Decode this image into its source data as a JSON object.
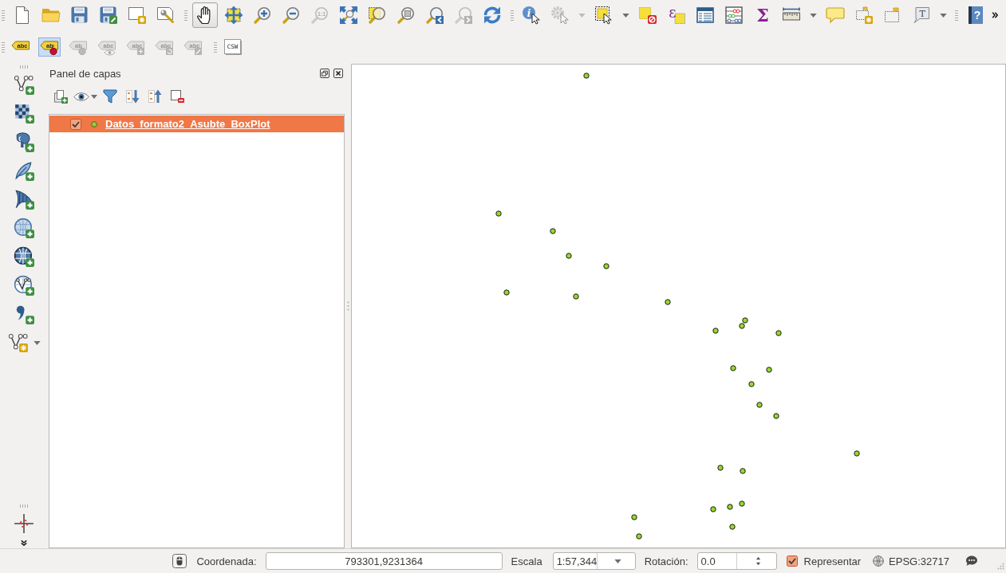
{
  "toolbar_rows": [
    [
      {
        "items": [
          {
            "kind": "new",
            "selected": false,
            "disabled": false
          },
          {
            "kind": "open",
            "selected": false,
            "disabled": false
          },
          {
            "kind": "save",
            "selected": false,
            "disabled": false
          },
          {
            "kind": "saveas",
            "selected": false,
            "disabled": false
          },
          {
            "kind": "newlayout",
            "selected": false,
            "disabled": false
          },
          {
            "kind": "layoutmanager",
            "selected": false,
            "disabled": false
          }
        ]
      },
      {
        "items": [
          {
            "kind": "pan",
            "selected": true,
            "disabled": false
          },
          {
            "kind": "pantoselection",
            "selected": false,
            "disabled": false
          },
          {
            "kind": "zoomin",
            "selected": false,
            "disabled": false
          },
          {
            "kind": "zoomout",
            "selected": false,
            "disabled": false
          },
          {
            "kind": "zoomnative",
            "glyph": "1:1",
            "selected": false,
            "disabled": true
          },
          {
            "kind": "zoomfull",
            "selected": false,
            "disabled": false
          },
          {
            "kind": "zoomlayer",
            "selected": false,
            "disabled": false
          },
          {
            "kind": "zoomselection",
            "selected": false,
            "disabled": false
          },
          {
            "kind": "zoomlast",
            "selected": false,
            "disabled": false
          },
          {
            "kind": "zoomnext",
            "selected": false,
            "disabled": true
          },
          {
            "kind": "refresh",
            "selected": false,
            "disabled": false
          }
        ]
      },
      {
        "items": [
          {
            "kind": "identify",
            "glyph": "i",
            "selected": false,
            "disabled": false
          },
          {
            "kind": "action",
            "selected": false,
            "disabled": true
          },
          {
            "kind": "dropdown",
            "disabled": true
          },
          {
            "kind": "select",
            "selected": false,
            "disabled": false
          },
          {
            "kind": "dropdown",
            "disabled": false
          },
          {
            "kind": "deselect",
            "selected": false,
            "disabled": false
          },
          {
            "kind": "expressionselect",
            "glyph": "ε",
            "selected": false,
            "disabled": false
          },
          {
            "kind": "attributetable",
            "selected": false,
            "disabled": false
          },
          {
            "kind": "fieldcalc",
            "selected": false,
            "disabled": false
          },
          {
            "kind": "statistics",
            "glyph": "Σ",
            "selected": false,
            "disabled": false
          },
          {
            "kind": "measure",
            "selected": false,
            "disabled": false
          },
          {
            "kind": "dropdown",
            "disabled": false
          },
          {
            "kind": "maptip",
            "selected": false,
            "disabled": false
          },
          {
            "kind": "newbookmark",
            "selected": false,
            "disabled": false
          },
          {
            "kind": "showbookmarks",
            "selected": false,
            "disabled": false
          },
          {
            "kind": "textannotation",
            "glyph": "T",
            "selected": false,
            "disabled": false
          },
          {
            "kind": "dropdown",
            "disabled": false
          }
        ]
      },
      {
        "items": [
          {
            "kind": "help",
            "glyph": "?",
            "selected": false,
            "disabled": false
          },
          {
            "kind": "overflow"
          }
        ]
      }
    ],
    [
      {
        "items": [
          {
            "kind": "label",
            "glyph": "abc",
            "selected": false,
            "disabled": false
          },
          {
            "kind": "labelstyle",
            "glyph": "ab",
            "selected": true,
            "disabled": false
          },
          {
            "kind": "pin",
            "glyph": "ab",
            "selected": false,
            "disabled": true
          },
          {
            "kind": "showhide",
            "glyph": "abc",
            "selected": false,
            "disabled": true
          },
          {
            "kind": "move",
            "glyph": "abc",
            "selected": false,
            "disabled": true
          },
          {
            "kind": "rotate",
            "glyph": "abc",
            "selected": false,
            "disabled": true
          },
          {
            "kind": "change",
            "glyph": "abc",
            "selected": false,
            "disabled": true
          }
        ]
      },
      {
        "items": [
          {
            "kind": "csw",
            "glyph": "CSW",
            "selected": false,
            "disabled": false
          }
        ]
      }
    ]
  ],
  "side_toolbars": [
    {
      "items": [
        {
          "kind": "addvector",
          "selected": false,
          "disabled": false
        },
        {
          "kind": "addraster",
          "selected": false,
          "disabled": false
        },
        {
          "kind": "addpostgis",
          "selected": false,
          "disabled": false
        },
        {
          "kind": "addspatialite",
          "selected": false,
          "disabled": false
        },
        {
          "kind": "addmssql",
          "selected": false,
          "disabled": false
        },
        {
          "kind": "addwms",
          "selected": false,
          "disabled": false
        },
        {
          "kind": "addwcs",
          "selected": false,
          "disabled": false
        },
        {
          "kind": "addwfs",
          "selected": false,
          "disabled": false
        },
        {
          "kind": "adddelimited",
          "selected": false,
          "disabled": false
        },
        {
          "kind": "newlayer",
          "selected": false,
          "disabled": false
        },
        {
          "kind": "dropdown",
          "disabled": false
        }
      ]
    },
    {
      "items": [
        {
          "kind": "capture",
          "selected": false,
          "disabled": false
        },
        {
          "kind": "overflow"
        }
      ]
    }
  ],
  "layers_panel": {
    "title": "Panel de capas",
    "tools": [
      {
        "kind": "addgroup"
      },
      {
        "kind": "visibility"
      },
      {
        "kind": "filter"
      },
      {
        "kind": "expandall"
      },
      {
        "kind": "collapseall"
      },
      {
        "kind": "remove"
      }
    ],
    "layers": [
      {
        "name": "Datos_formato2_Asubte_BoxPlot",
        "checked": true,
        "selected": true
      }
    ]
  },
  "status_bar": {
    "coordinate_label": "Coordenada:",
    "coordinate": "793301,9231364",
    "scale_label": "Escala",
    "scale": "1:57,344",
    "rotation_label": "Rotación:",
    "rotation": "0.0",
    "render": {
      "label": "Representar",
      "checked": true
    },
    "crs": "EPSG:32717"
  }
}
